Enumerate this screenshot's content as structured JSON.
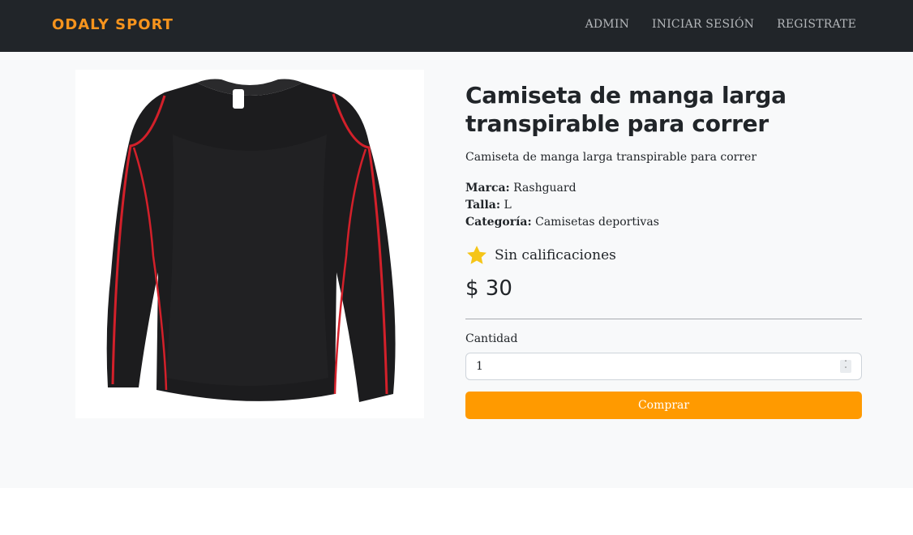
{
  "navbar": {
    "brand": "ODALY SPORT",
    "links": [
      "ADMIN",
      "INICIAR SESIÓN",
      "REGISTRATE"
    ]
  },
  "product": {
    "title": "Camiseta de manga larga transpirable para correr",
    "description": "Camiseta de manga larga transpirable para correr",
    "brand_label": "Marca:",
    "brand_value": "Rashguard",
    "size_label": "Talla:",
    "size_value": "L",
    "category_label": "Categoría:",
    "category_value": "Camisetas deportivas",
    "rating_text": "Sin calificaciones",
    "price": "$ 30"
  },
  "purchase": {
    "quantity_label": "Cantidad",
    "quantity_value": "1",
    "buy_label": "Comprar"
  },
  "colors": {
    "brand": "#f7941d",
    "navbar_bg": "#212529",
    "buy_button": "#ff9a00",
    "star": "#f5c518",
    "shirt_body": "#1c1c1e",
    "shirt_piping": "#d3202a"
  },
  "icons": {
    "rating": "star-icon",
    "spinner": "stepper-arrows-icon"
  }
}
